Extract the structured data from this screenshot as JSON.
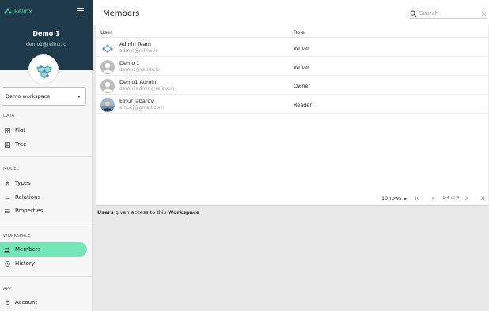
{
  "app": {
    "brand": "Relinx",
    "accent": "#57d6ad",
    "header_bg": "#1f3a4a"
  },
  "sidebar": {
    "user_name": "Demo 1",
    "user_email": "demo1@relinx.io",
    "workspace_select": "Demo workspace",
    "sections": {
      "data": "DATA",
      "model": "MODEL",
      "workspace": "WORKSPACE",
      "app": "APP"
    },
    "items": {
      "flat": "Flat",
      "tree": "Tree",
      "types": "Types",
      "relations": "Relations",
      "properties": "Properties",
      "members": "Members",
      "history": "History",
      "account": "Account"
    }
  },
  "main": {
    "title": "Members",
    "search_placeholder": "Search",
    "columns": {
      "user": "User",
      "role": "Role"
    },
    "rows": [
      {
        "name": "Admin Team",
        "email": "admin@relinx.io",
        "role": "Writer"
      },
      {
        "name": "Demo 1",
        "email": "demo1@relinx.io",
        "role": "Writer"
      },
      {
        "name": "Demo1 Admin",
        "email": "demo1admin@relinx.io",
        "role": "Owner"
      },
      {
        "name": "Elnur Jabarov",
        "email": "elnur.j@gmail.com",
        "role": "Reader"
      }
    ],
    "pagination": {
      "rows_per_page": "10 rows",
      "range": "1-4 of 4"
    },
    "caption": {
      "strong1": "Users",
      "middle": " given access to this ",
      "strong2": "Workspace"
    }
  }
}
